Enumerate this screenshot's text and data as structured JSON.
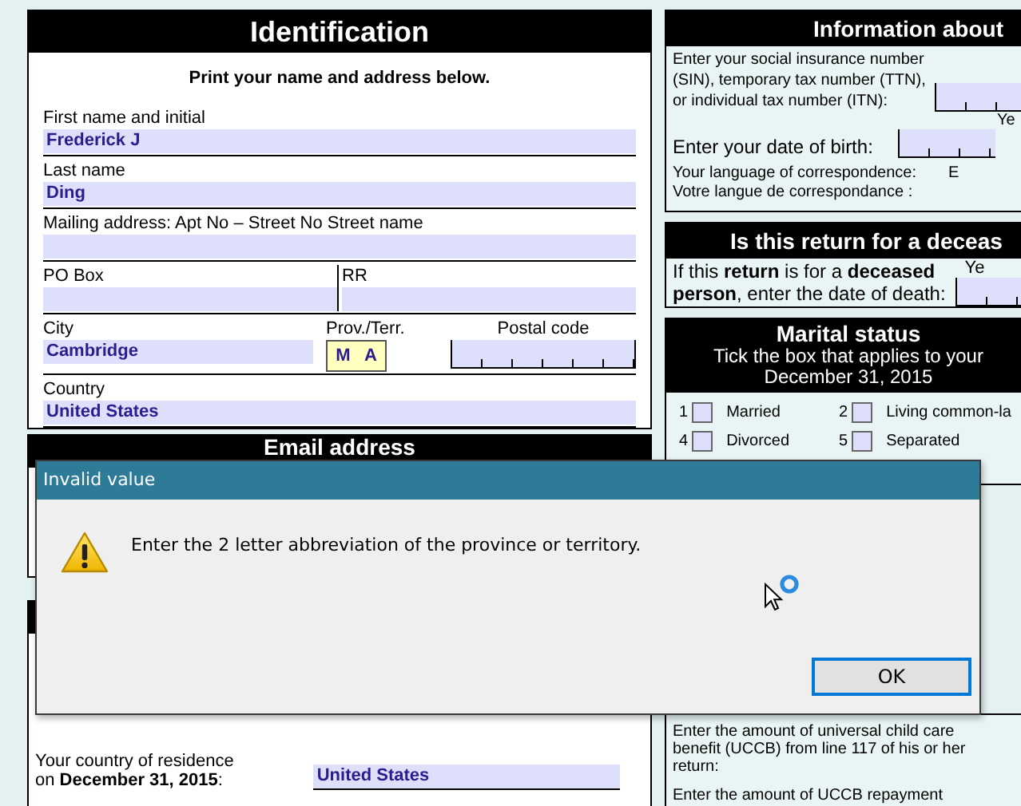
{
  "identification": {
    "title": "Identification",
    "instruction": "Print your name and address below.",
    "rows": [
      [
        {
          "kind": "text",
          "label": "First name and initial",
          "value": "Frederick J"
        }
      ],
      [
        {
          "kind": "text",
          "label": "Last name",
          "value": "Ding"
        }
      ],
      [
        {
          "kind": "text",
          "label": "Mailing address: Apt No  –  Street No Street name"
        }
      ],
      [
        {
          "kind": "text",
          "label": "PO Box"
        },
        {
          "kind": "text",
          "label": "RR"
        }
      ],
      [
        {
          "kind": "text",
          "label": "City",
          "value": "Cambridge"
        },
        {
          "kind": "province",
          "label": "Prov./Terr.",
          "letters": [
            "M",
            "A"
          ],
          "highlighted": true
        },
        {
          "kind": "boxes",
          "label": "Postal code"
        }
      ],
      [
        {
          "kind": "text",
          "label": "Country",
          "value": "United States"
        }
      ]
    ]
  },
  "email": {
    "title": "Email address"
  },
  "residence": {
    "label_lines": [
      "Your country of residence",
      "on **December 31, 2015**:"
    ],
    "value": "United States"
  },
  "info": {
    "title": "Information about",
    "sin_lines": [
      "Enter your social insurance number",
      "(SIN), temporary tax number (TTN),",
      "or individual tax number (ITN):"
    ],
    "year_label": "Ye",
    "dob_label": "Enter your date of birth:",
    "language_lines": [
      "Your language of correspondence:",
      "Votre langue de correspondance :"
    ],
    "language_value": "E"
  },
  "deceased": {
    "title": "Is this return for a deceas",
    "text_lines": [
      "If this **return** is for a **deceased**",
      "**person**, enter the date of death:"
    ],
    "year_label": "Ye"
  },
  "marital": {
    "title": "Marital status",
    "subtitle_lines": [
      "Tick the box that applies to your",
      "December 31, 2015"
    ],
    "options": [
      {
        "number": "1",
        "label": "Married",
        "checked": false
      },
      {
        "number": "2",
        "label": "Living common-la",
        "checked": false
      },
      {
        "number": "4",
        "label": "Divorced",
        "checked": false
      },
      {
        "number": "5",
        "label": "Separated",
        "checked": false
      }
    ]
  },
  "uccb": {
    "texts": [
      "Enter the amount of universal child care benefit (UCCB) from line 117 of his or her return:",
      "Enter the amount of UCCB repayment"
    ]
  },
  "dialog": {
    "title": "Invalid value",
    "message": "Enter the 2 letter abbreviation of the province or territory.",
    "buttons": [
      {
        "label": "OK",
        "default": true
      }
    ]
  }
}
